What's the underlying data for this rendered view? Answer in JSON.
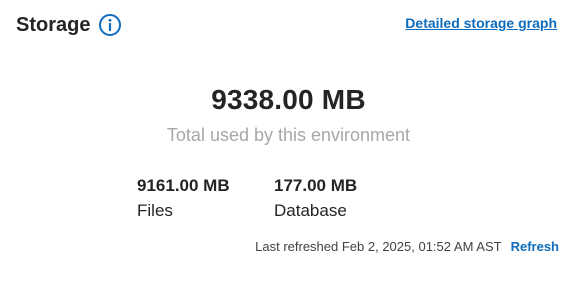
{
  "header": {
    "title": "Storage",
    "graph_link": "Detailed storage graph"
  },
  "summary": {
    "total": "9338.00 MB",
    "caption": "Total used by this environment"
  },
  "breakdown": [
    {
      "value": "9161.00 MB",
      "label": "Files"
    },
    {
      "value": "177.00 MB",
      "label": "Database"
    }
  ],
  "footer": {
    "last_refreshed": "Last refreshed Feb 2, 2025, 01:52 AM AST",
    "refresh_label": "Refresh"
  },
  "colors": {
    "accent": "#0f6cbd",
    "text": "#242424",
    "muted": "#a8a8a8"
  },
  "icons": {
    "info": "info-circle-icon"
  }
}
